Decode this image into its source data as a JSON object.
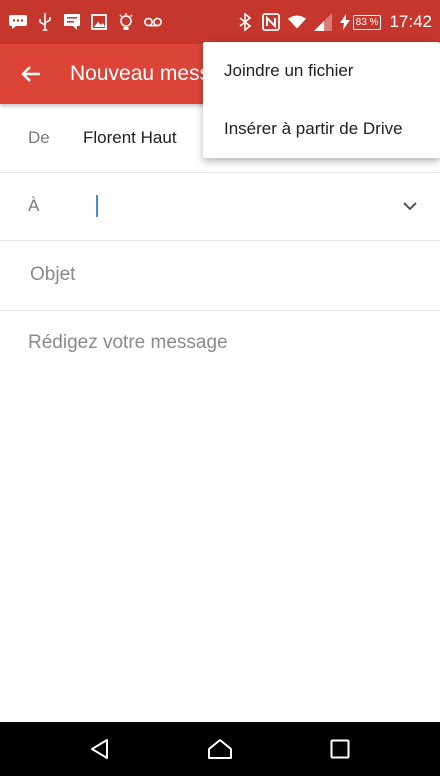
{
  "status_bar": {
    "time": "17:42",
    "battery": "83 %",
    "icons": [
      "message-icon",
      "usb-icon",
      "chat-icon",
      "image-icon",
      "lightbulb-icon",
      "voicemail-icon",
      "bluetooth-icon",
      "nfc-icon",
      "wifi-icon",
      "signal-icon",
      "charging-icon"
    ]
  },
  "app_bar": {
    "title": "Nouveau message",
    "color": "#db4437"
  },
  "compose": {
    "from_label": "De",
    "from_value": "Florent Haut",
    "to_label": "À",
    "subject_placeholder": "Objet",
    "body_placeholder": "Rédigez votre message"
  },
  "menu": {
    "items": [
      {
        "label": "Joindre un fichier"
      },
      {
        "label": "Insérer à partir de Drive"
      }
    ]
  },
  "nav_bar": {
    "buttons": [
      "back",
      "home",
      "recents"
    ]
  }
}
